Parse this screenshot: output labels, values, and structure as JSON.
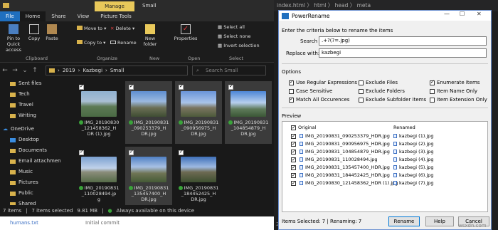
{
  "explorer": {
    "title": "Small",
    "manage_tab": "Manage",
    "tabs": [
      "File",
      "Home",
      "Share",
      "View",
      "Picture Tools"
    ],
    "ribbon": {
      "pin": "Pin to Quick access",
      "copy": "Copy",
      "paste": "Paste",
      "move_to": "Move to",
      "copy_to": "Copy to",
      "delete": "Delete",
      "rename": "Rename",
      "new_folder": "New folder",
      "properties": "Properties",
      "select_all": "Select all",
      "select_none": "Select none",
      "invert": "Invert selection",
      "groups": [
        "Clipboard",
        "Organize",
        "New",
        "Open",
        "Select"
      ]
    },
    "path": [
      "2019",
      "Kazbegi",
      "Small"
    ],
    "search_placeholder": "Search Small",
    "nav": [
      "Sent files",
      "Tech",
      "Travel",
      "Writing",
      "OneDrive",
      "Desktop",
      "Documents",
      "Email attachmen",
      "Music",
      "Pictures",
      "Public",
      "Shared"
    ],
    "files": [
      {
        "name": "IMG_20190830_121458362_HDR (1).jpg",
        "l1": "IMG_20190830",
        "l2": "_121458362_H",
        "l3": "DR (1).jpg",
        "sel": false
      },
      {
        "name": "IMG_20190831_090253379_HDR.jpg",
        "l1": "IMG_20190831",
        "l2": "_090253379_H",
        "l3": "DR.jpg",
        "sel": true
      },
      {
        "name": "IMG_20190831_090956975_HDR.jpg",
        "l1": "IMG_20190831",
        "l2": "_090956975_H",
        "l3": "DR.jpg",
        "sel": true
      },
      {
        "name": "IMG_20190831_104854879_HDR.jpg",
        "l1": "IMG_20190831",
        "l2": "_104854879_H",
        "l3": "DR.jpg",
        "sel": true
      },
      {
        "name": "IMG_20190831_110028494.jpg",
        "l1": "IMG_20190831",
        "l2": "_110028494.jp",
        "l3": "g",
        "sel": false
      },
      {
        "name": "IMG_20190831_135457400_HDR.jpg",
        "l1": "IMG_20190831",
        "l2": "_135457400_H",
        "l3": "DR.jpg",
        "sel": true
      },
      {
        "name": "IMG_20190831_184452425_HDR.jpg",
        "l1": "IMG_20190831",
        "l2": "_184452425_H",
        "l3": "DR.jpg",
        "sel": false
      }
    ],
    "status": {
      "items": "7 items",
      "selected": "7 items selected",
      "size": "9.81 MB",
      "avail": "Always available on this device"
    },
    "bottom_file": "humans.txt",
    "bottom_commit": "Initial commit"
  },
  "editor": {
    "breadcrumb": "index.html 〉 html 〉 head 〉 meta",
    "line": "27"
  },
  "powerrename": {
    "title": "PowerRename",
    "criteria": "Enter the criteria below to rename the items",
    "search_label": "Search for:",
    "search_value": ".+?(?=.jpg)",
    "replace_label": "Replace with:",
    "replace_value": "kazbegi",
    "options_label": "Options",
    "options": [
      {
        "label": "Use Regular Expressions",
        "on": true
      },
      {
        "label": "Case Sensitive",
        "on": false
      },
      {
        "label": "Match All Occurences",
        "on": true
      },
      {
        "label": "Exclude Files",
        "on": false
      },
      {
        "label": "Exclude Folders",
        "on": false
      },
      {
        "label": "Exclude Subfolder Items",
        "on": false
      },
      {
        "label": "Enumerate Items",
        "on": true
      },
      {
        "label": "Item Name Only",
        "on": false
      },
      {
        "label": "Item Extension Only",
        "on": false
      }
    ],
    "preview_label": "Preview",
    "col_original": "Original",
    "col_renamed": "Renamed",
    "rows": [
      {
        "o": "IMG_20190831_090253379_HDR.jpg",
        "r": "kazbegi (1).jpg"
      },
      {
        "o": "IMG_20190831_090956975_HDR.jpg",
        "r": "kazbegi (2).jpg"
      },
      {
        "o": "IMG_20190831_104854879_HDR.jpg",
        "r": "kazbegi (3).jpg"
      },
      {
        "o": "IMG_20190831_110028494.jpg",
        "r": "kazbegi (4).jpg"
      },
      {
        "o": "IMG_20190831_135457400_HDR.jpg",
        "r": "kazbegi (5).jpg"
      },
      {
        "o": "IMG_20190831_184452425_HDR.jpg",
        "r": "kazbegi (6).jpg"
      },
      {
        "o": "IMG_20190830_121458362_HDR (1).jpg",
        "r": "kazbegi (7).jpg"
      }
    ],
    "status": "Items Selected: 7 | Renaming: 7",
    "rename_btn": "Rename",
    "help_btn": "Help",
    "cancel_btn": "Cancel"
  },
  "watermark": "wsxdn.com"
}
